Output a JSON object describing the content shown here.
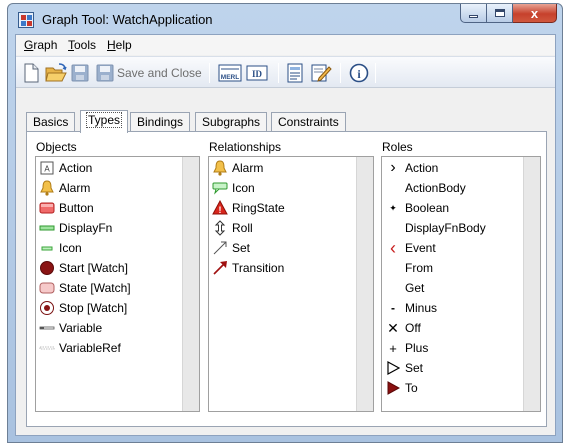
{
  "window": {
    "title": "Graph Tool: WatchApplication",
    "close_glyph": "x"
  },
  "menu": {
    "graph": "Graph",
    "tools": "Tools",
    "help": "Help",
    "graph_mnemonic": "G",
    "graph_rest": "raph",
    "tools_mnemonic": "T",
    "tools_rest": "ools",
    "help_mnemonic": "H",
    "help_rest": "elp"
  },
  "toolbar": {
    "save_and_close_label": "Save and Close",
    "merl_label": "MERL",
    "id_label": "ID",
    "info_label": "i"
  },
  "tabs": [
    {
      "label": "Basics",
      "active": false
    },
    {
      "label": "Types",
      "active": true
    },
    {
      "label": "Bindings",
      "active": false
    },
    {
      "label": "Subgraphs",
      "active": false
    },
    {
      "label": "Constraints",
      "active": false
    }
  ],
  "objects": {
    "header": "Objects",
    "items": [
      {
        "label": "Action",
        "icon": "action-box-icon"
      },
      {
        "label": "Alarm",
        "icon": "bell-icon"
      },
      {
        "label": "Button",
        "icon": "red-rectangle-icon"
      },
      {
        "label": "DisplayFn",
        "icon": "green-bar-icon"
      },
      {
        "label": "Icon",
        "icon": "small-green-bar-icon"
      },
      {
        "label": "Start [Watch]",
        "icon": "filled-circle-icon"
      },
      {
        "label": "State [Watch]",
        "icon": "rounded-rectangle-icon"
      },
      {
        "label": "Stop [Watch]",
        "icon": "target-circle-icon"
      },
      {
        "label": "Variable",
        "icon": "variable-line-icon"
      },
      {
        "label": "VariableRef",
        "icon": "dotted-line-icon"
      }
    ],
    "action_glyph": "A"
  },
  "relationships": {
    "header": "Relationships",
    "items": [
      {
        "label": "Alarm",
        "icon": "bell-icon"
      },
      {
        "label": "Icon",
        "icon": "speech-bubble-icon"
      },
      {
        "label": "RingState",
        "icon": "warning-triangle-icon"
      },
      {
        "label": "Roll",
        "icon": "vertical-arrows-icon"
      },
      {
        "label": "Set",
        "icon": "diagonal-arrow-icon"
      },
      {
        "label": "Transition",
        "icon": "red-arrow-icon"
      }
    ],
    "warning_glyph": "!"
  },
  "roles": {
    "header": "Roles",
    "items": [
      {
        "label": "Action",
        "icon": "chevron-right-icon"
      },
      {
        "label": "ActionBody",
        "icon": ""
      },
      {
        "label": "Boolean",
        "icon": "plus-small-icon"
      },
      {
        "label": "DisplayFnBody",
        "icon": ""
      },
      {
        "label": "Event",
        "icon": "red-chevron-left-icon"
      },
      {
        "label": "From",
        "icon": ""
      },
      {
        "label": "Get",
        "icon": ""
      },
      {
        "label": "Minus",
        "icon": "minus-icon"
      },
      {
        "label": "Off",
        "icon": "x-icon"
      },
      {
        "label": "Plus",
        "icon": "plus-icon"
      },
      {
        "label": "Set",
        "icon": "outline-triangle-icon"
      },
      {
        "label": "To",
        "icon": "red-triangle-icon"
      }
    ],
    "glyphs": {
      "action": "›",
      "boolean": "✦",
      "event": "‹",
      "minus": "-",
      "off": "✕",
      "plus": "+"
    }
  }
}
